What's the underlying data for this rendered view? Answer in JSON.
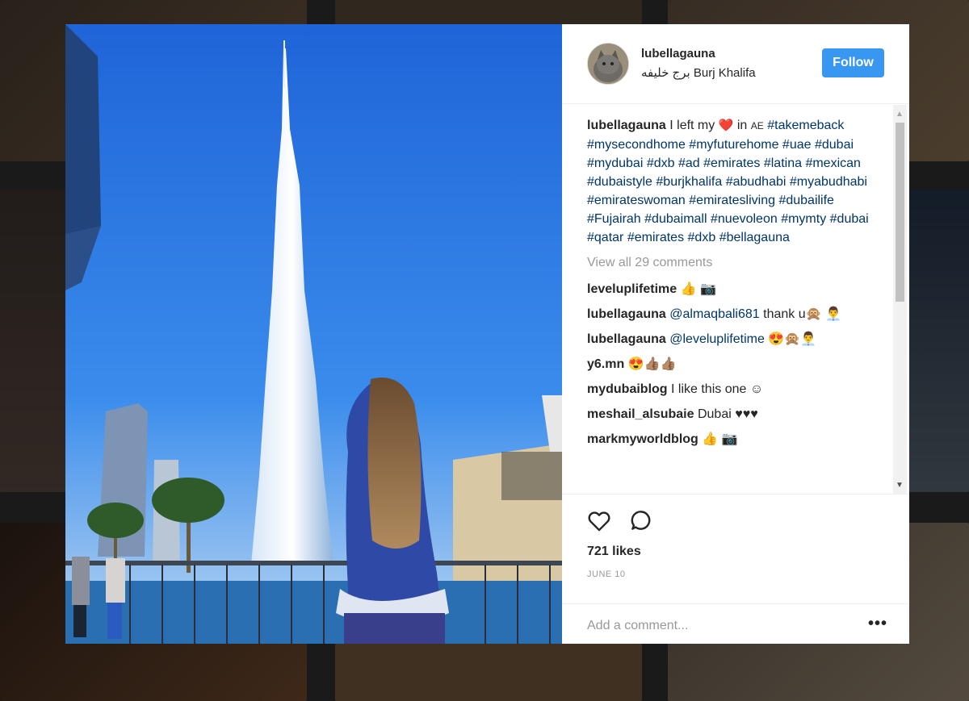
{
  "post": {
    "username": "lubellagauna",
    "location": "برج خليفه Burj Khalifa",
    "follow_label": "Follow"
  },
  "caption": {
    "username": "lubellagauna",
    "text_before": "I left my",
    "heart": "❤️",
    "text_after": "in",
    "flag": "AE",
    "hashtags": [
      "#takemeback",
      "#mysecondhome",
      "#myfuturehome",
      "#uae",
      "#dubai",
      "#mydubai",
      "#dxb",
      "#ad",
      "#emirates",
      "#latina",
      "#mexican",
      "#dubaistyle",
      "#burjkhalifa",
      "#abudhabi",
      "#myabudhabi",
      "#emirateswoman",
      "#emiratesliving",
      "#dubailife",
      "#Fujairah",
      "#dubaimall",
      "#nuevoleon",
      "#mymty",
      "#dubai",
      "#qatar",
      "#emirates",
      "#dxb",
      "#bellagauna"
    ]
  },
  "view_all_comments": "View all 29 comments",
  "comments": [
    {
      "user": "leveluplifetime",
      "mention": "",
      "text": "👍 📷"
    },
    {
      "user": "lubellagauna",
      "mention": "@almaqbali681",
      "text": "thank u🙊 👨‍💼"
    },
    {
      "user": "lubellagauna",
      "mention": "@leveluplifetime",
      "text": "😍🙊👨‍💼"
    },
    {
      "user": "y6.mn",
      "mention": "",
      "text": "😍👍🏽👍🏽"
    },
    {
      "user": "mydubaiblog",
      "mention": "",
      "text": "I like this one ☺"
    },
    {
      "user": "meshail_alsubaie",
      "mention": "",
      "text": "Dubai ♥♥♥"
    },
    {
      "user": "markmyworldblog",
      "mention": "",
      "text": "👍 📷"
    }
  ],
  "likes": "721 likes",
  "date": "JUNE 10",
  "add_comment_placeholder": "Add a comment...",
  "more_options": "•••",
  "icons": {
    "heart": "heart-outline-icon",
    "comment": "speech-bubble-icon",
    "scroll_up": "▲",
    "scroll_down": "▼"
  },
  "colors": {
    "follow": "#3897f0",
    "hashtag": "#003569",
    "muted": "#999999",
    "sky": "#2f78e0"
  }
}
